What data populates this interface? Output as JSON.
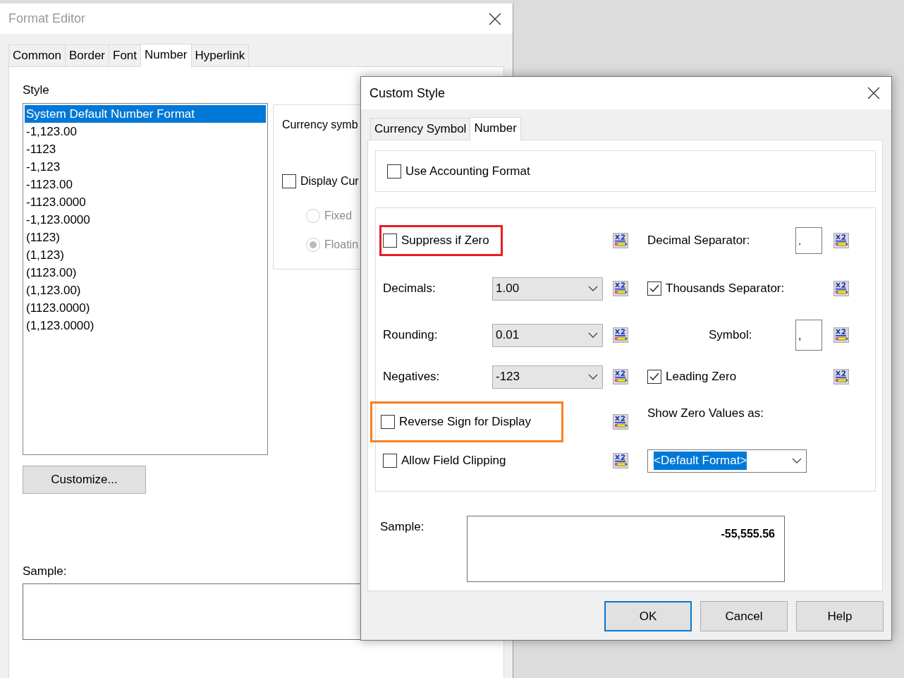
{
  "format_editor": {
    "title": "Format Editor",
    "tabs": [
      {
        "label": "Common",
        "selected": false
      },
      {
        "label": "Border",
        "selected": false
      },
      {
        "label": "Font",
        "selected": false
      },
      {
        "label": "Number",
        "selected": true
      },
      {
        "label": "Hyperlink",
        "selected": false
      }
    ],
    "style_label": "Style",
    "style_list": [
      {
        "text": "System Default Number Format",
        "selected": true
      },
      {
        "text": "-1,123.00",
        "selected": false
      },
      {
        "text": "-1123",
        "selected": false
      },
      {
        "text": "-1,123",
        "selected": false
      },
      {
        "text": "-1123.00",
        "selected": false
      },
      {
        "text": "-1123.0000",
        "selected": false
      },
      {
        "text": "-1,123.0000",
        "selected": false
      },
      {
        "text": "(1123)",
        "selected": false
      },
      {
        "text": "(1,123)",
        "selected": false
      },
      {
        "text": "(1123.00)",
        "selected": false
      },
      {
        "text": "(1,123.00)",
        "selected": false
      },
      {
        "text": "(1123.0000)",
        "selected": false
      },
      {
        "text": "(1,123.0000)",
        "selected": false
      }
    ],
    "currency_group": {
      "label": "Currency symb",
      "display_checkbox": {
        "label": "Display Cur",
        "checked": false
      },
      "radios": [
        {
          "label": "Fixed",
          "selected": false,
          "disabled": true
        },
        {
          "label": "Floatin",
          "selected": true,
          "disabled": true
        }
      ]
    },
    "customize_button": "Customize...",
    "sample_label": "Sample:"
  },
  "custom_style": {
    "title": "Custom Style",
    "tabs": [
      {
        "label": "Currency Symbol",
        "selected": false
      },
      {
        "label": "Number",
        "selected": true
      }
    ],
    "use_accounting": {
      "label": "Use Accounting Format",
      "checked": false
    },
    "left_options": [
      {
        "kind": "checkbox",
        "label": "Suppress if Zero",
        "checked": false,
        "color": "#e81c24"
      },
      {
        "kind": "select",
        "label": "Decimals:",
        "value": "1.00"
      },
      {
        "kind": "select",
        "label": "Rounding:",
        "value": "0.01"
      },
      {
        "kind": "select",
        "label": "Negatives:",
        "value": "-123"
      },
      {
        "kind": "checkbox",
        "label": "Reverse Sign for Display",
        "checked": false,
        "color": "#f58025"
      },
      {
        "kind": "checkbox",
        "label": "Allow Field Clipping",
        "checked": false
      }
    ],
    "right_options": [
      {
        "kind": "text_input",
        "label": "Decimal Separator:",
        "value": ".",
        "has_formula": true
      },
      {
        "kind": "checkbox",
        "label": "Thousands Separator:",
        "checked": true,
        "has_formula": true
      },
      {
        "kind": "text_input",
        "label": "Symbol:",
        "value": ",",
        "has_formula": true
      },
      {
        "kind": "checkbox",
        "label": "Leading Zero",
        "checked": true,
        "has_formula": true
      },
      {
        "kind": "caption",
        "label": "Show Zero Values as:",
        "has_formula": false
      },
      {
        "kind": "select",
        "value": "<Default Format>",
        "value_highlighted": true,
        "has_formula": false
      }
    ],
    "sample_label": "Sample:",
    "sample_value": "-55,555.56",
    "buttons": [
      {
        "label": "OK",
        "default": true
      },
      {
        "label": "Cancel",
        "default": false
      },
      {
        "label": "Help",
        "default": false
      }
    ]
  }
}
